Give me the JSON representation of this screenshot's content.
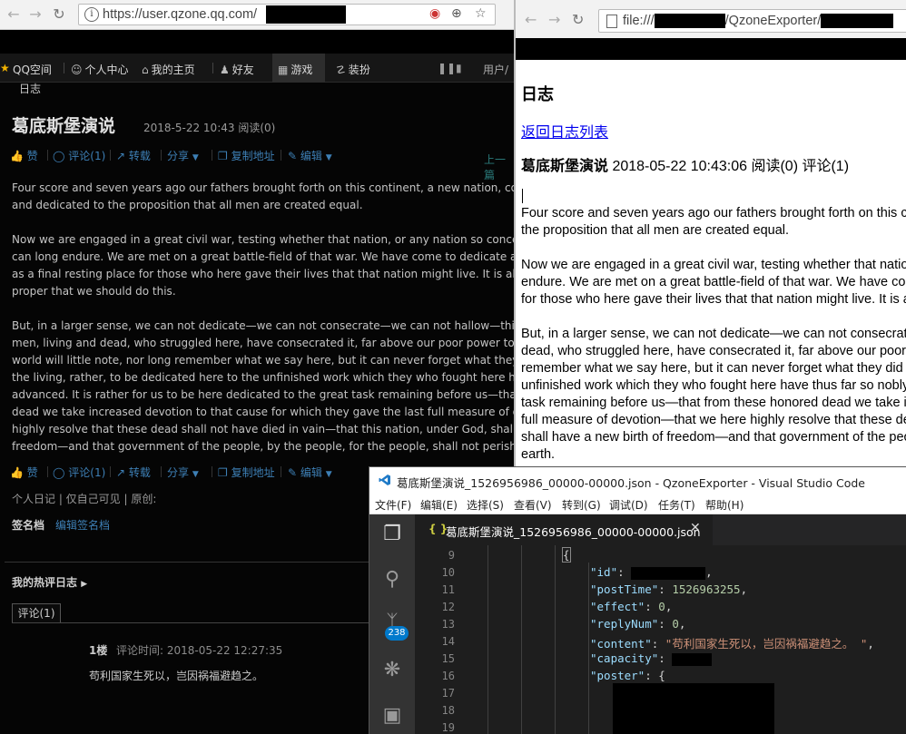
{
  "left_browser": {
    "url": "https://user.qzone.qq.com/",
    "navbar": {
      "logo": "QQ空间",
      "items": [
        "个人中心",
        "我的主页",
        "好友",
        "游戏",
        "装扮"
      ],
      "user_partial": "用户/"
    },
    "section_label": "日志",
    "post": {
      "title": "葛底斯堡演说",
      "meta": "2018-5-22 10:43  阅读(0)",
      "actions": [
        "赞",
        "评论(1)",
        "转载",
        "分享",
        "复制地址",
        "编辑"
      ],
      "prev_link": "上一篇",
      "paragraphs": [
        [
          "Four score and seven years ago our fathers brought forth on this continent, a new nation, conceived in Liberty,",
          "and dedicated to the proposition that all men are created equal."
        ],
        [
          "Now we are engaged in a great civil war, testing whether that nation, or any nation so conceived and so dedicated,",
          "can long endure. We are met on a great battle-field of that war. We have come to dedicate a portion of that field,",
          "as a final resting place for those who here gave their lives that that nation might live. It is altogether fitting and",
          "proper that we should do this."
        ],
        [
          "But, in a larger sense, we can not dedicate—we can not consecrate—we can not hallow—this ground. The brave",
          "men, living and dead, who struggled here, have consecrated it, far above our poor power to add or detract. The",
          "world will little note, nor long remember what we say here, but it can never forget what they did here. It is for us",
          "the living, rather, to be dedicated here to the unfinished work which they who fought here have thus far so nobly",
          "advanced. It is rather for us to be here dedicated to the great task remaining before us—that from these honored",
          "dead we take increased devotion to that cause for which they gave the last full measure of devotion—that we here",
          "highly resolve that these dead shall not have died in vain—that this nation, under God, shall have a new birth of",
          "freedom—and that government of the people, by the people, for the people, shall not perish from the earth."
        ]
      ],
      "footer_meta": "个人日记 | 仅自己可见 | 原创:",
      "signature_label": "签名档",
      "signature_edit": "编辑签名档",
      "hot_comments": "我的热评日志",
      "comments_tab": "评论(1)",
      "comment": {
        "floor": "1楼",
        "time": "评论时间: 2018-05-22 12:27:35",
        "text": "苟利国家生死以，岂因祸福避趋之。"
      }
    }
  },
  "right_browser": {
    "url_prefix": "file:///",
    "url_mid": "/QzoneExporter/",
    "heading": "日志",
    "back_link": "返回日志列表",
    "meta_title": "葛底斯堡演说",
    "meta_rest": " 2018-05-22 10:43:06 阅读(0) 评论(1)",
    "paragraphs": [
      [
        "Four score and seven years ago our fathers brought forth on this continent, a new nation,",
        "the proposition that all men are created equal."
      ],
      [
        "Now we are engaged in a great civil war, testing whether that nation, or any nation so",
        "endure. We are met on a great battle-field of that war. We have come to dedicate a portion",
        "for those who here gave their lives that that nation might live. It is altogether fitting"
      ],
      [
        "But, in a larger sense, we can not dedicate—we can not consecrate—we can not hallow",
        "dead, who struggled here, have consecrated it, far above our poor power to add or detract.",
        "remember what we say here, but it can never forget what they did here. It is for us",
        "unfinished work which they who fought here have thus far so nobly advanced. It is",
        "task remaining before us—that from these honored dead we take increased devotion",
        "full measure of devotion—that we here highly resolve that these dead shall not have",
        "shall have a new birth of freedom—and that government of the people, by the people,",
        "earth."
      ]
    ]
  },
  "vscode": {
    "title": "葛底斯堡演说_1526956986_00000-00000.json - QzoneExporter - Visual Studio Code",
    "menu": [
      "文件(F)",
      "编辑(E)",
      "选择(S)",
      "查看(V)",
      "转到(G)",
      "调试(D)",
      "任务(T)",
      "帮助(H)"
    ],
    "tab_label": "葛底斯堡演说_1526956986_00000-00000.json",
    "scm_badge": "238",
    "line_numbers": [
      "9",
      "10",
      "11",
      "12",
      "13",
      "14",
      "15",
      "16",
      "17",
      "18",
      "19"
    ],
    "lines": [
      {
        "key": "",
        "value": ""
      },
      {
        "key": "\"id\"",
        "value": ""
      },
      {
        "key": "\"postTime\"",
        "value": "1526963255"
      },
      {
        "key": "\"effect\"",
        "value": "0"
      },
      {
        "key": "\"replyNum\"",
        "value": "0"
      },
      {
        "key": "\"content\"",
        "value": "\"苟利国家生死以，岂因祸福避趋之。 \""
      },
      {
        "key": "\"capacity\"",
        "value": ""
      },
      {
        "key": "\"poster\"",
        "value": "{"
      }
    ]
  }
}
